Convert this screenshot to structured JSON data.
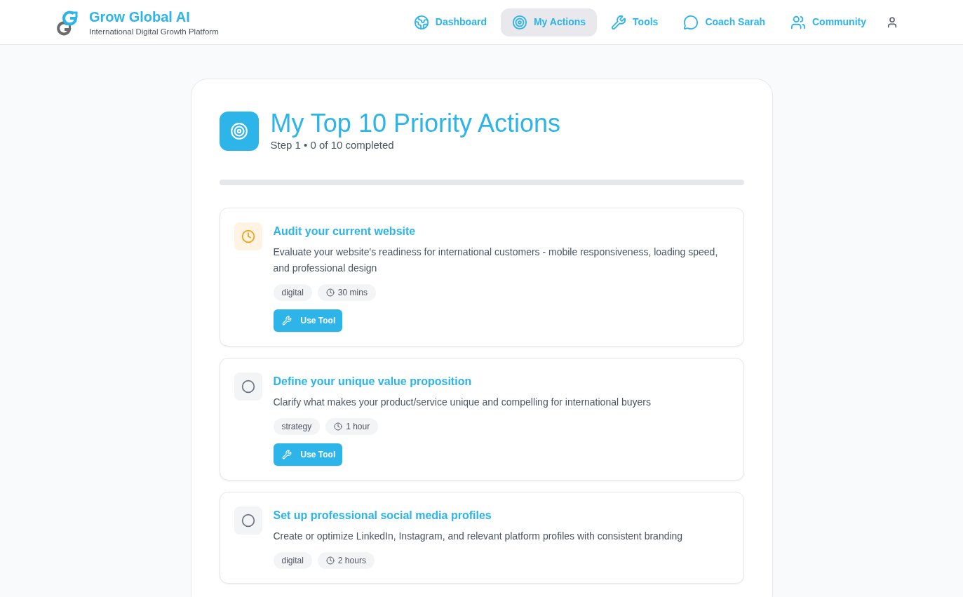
{
  "header": {
    "brand": {
      "title": "Grow Global AI",
      "subtitle": "International Digital Growth Platform"
    },
    "nav": [
      {
        "label": "Dashboard",
        "selected": false
      },
      {
        "label": "My Actions",
        "selected": true
      },
      {
        "label": "Tools",
        "selected": false
      },
      {
        "label": "Coach Sarah",
        "selected": false
      },
      {
        "label": "Community",
        "selected": false
      }
    ]
  },
  "page": {
    "title": "My Top 10 Priority Actions",
    "subtitle": "Step 1 • 0 of 10 completed",
    "progress": {
      "level": 0
    },
    "actions": [
      {
        "title": "Audit your current website",
        "description": "Evaluate your website's readiness for international customers - mobile responsiveness, loading speed, and professional design",
        "in_progress": true,
        "tags": [
          {
            "kind": "category",
            "label": "digital"
          },
          {
            "kind": "duration",
            "label": "30 mins"
          }
        ],
        "button": "Use Tool"
      },
      {
        "title": "Define your unique value proposition",
        "description": "Clarify what makes your product/service unique and compelling for international buyers",
        "in_progress": false,
        "tags": [
          {
            "kind": "category",
            "label": "strategy"
          },
          {
            "kind": "duration",
            "label": "1 hour"
          }
        ],
        "button": "Use Tool"
      },
      {
        "title": "Set up professional social media profiles",
        "description": "Create or optimize LinkedIn, Instagram, and relevant platform profiles with consistent branding",
        "in_progress": false,
        "tags": [
          {
            "kind": "category",
            "label": "digital"
          },
          {
            "kind": "duration",
            "label": "2 hours"
          }
        ]
      }
    ]
  }
}
